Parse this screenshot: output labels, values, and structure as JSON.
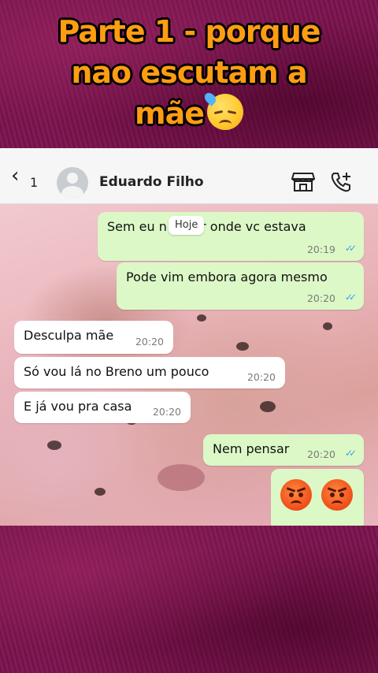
{
  "headline": {
    "line1": "Parte 1 - porque",
    "line2": "nao escutam a",
    "line3": "mãe",
    "emoji": "sad-sweat-face-icon"
  },
  "header": {
    "back_label": "‹",
    "back_count": "1",
    "contact_name": "Eduardo Filho",
    "icons": [
      "store-icon",
      "add-call-icon"
    ]
  },
  "date_pill": "Hoje",
  "messages": [
    {
      "dir": "out",
      "text": "Sem eu n saber onde vc estava",
      "time": "20:19",
      "read": true
    },
    {
      "dir": "out",
      "text": "Pode vim embora agora mesmo",
      "time": "20:20",
      "read": true
    },
    {
      "dir": "in",
      "text": "Desculpa mãe",
      "time": "20:20"
    },
    {
      "dir": "in",
      "text": "Só vou lá no Breno um pouco",
      "time": "20:20"
    },
    {
      "dir": "in",
      "text": "E já vou pra casa",
      "time": "20:20"
    },
    {
      "dir": "out",
      "text": "Nem pensar",
      "time": "20:20",
      "read": true
    },
    {
      "dir": "out",
      "text": "",
      "emoji": [
        "angry-face-icon",
        "angry-face-icon"
      ]
    }
  ],
  "colors": {
    "headline": "#ff9d12",
    "outgoing_bubble": "#dcf8c6",
    "incoming_bubble": "#ffffff",
    "read_ticks": "#34a4e8",
    "frame_background": "#7d1450"
  }
}
